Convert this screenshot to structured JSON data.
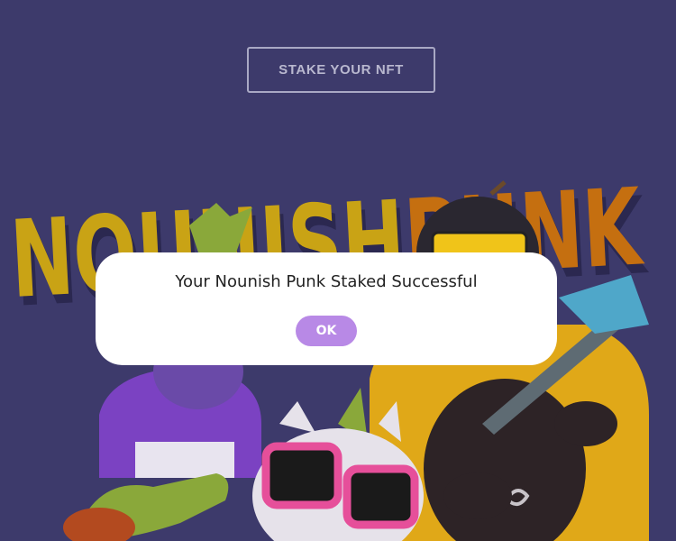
{
  "header": {
    "stake_button_label": "STAKE YOUR NFT"
  },
  "hero": {
    "logo_text": "NOUNISHPUNK",
    "logo_part1": "NOUNISH",
    "logo_part2": "PUNK"
  },
  "modal": {
    "message": "Your Nounish Punk Staked Successful",
    "ok_label": "OK"
  },
  "colors": {
    "background": "#3d3a6b",
    "logo_yellow": "#c9a315",
    "logo_orange": "#c56f10",
    "ok_button": "#b889e6"
  }
}
